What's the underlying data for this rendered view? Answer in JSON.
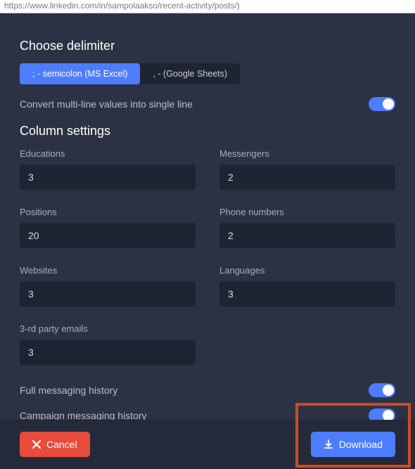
{
  "url": "https://www.linkedin.com/in/sampolaakso/recent-activity/posts/)",
  "delimiter": {
    "title": "Choose delimiter",
    "opt_semicolon": "; - semicolon (MS Excel)",
    "opt_comma": ", - (Google Sheets)"
  },
  "convert_line": "Convert multi-line values into single line",
  "columns": {
    "title": "Column settings",
    "educations_label": "Educations",
    "educations_value": "3",
    "messengers_label": "Messengers",
    "messengers_value": "2",
    "positions_label": "Positions",
    "positions_value": "20",
    "phones_label": "Phone numbers",
    "phones_value": "2",
    "websites_label": "Websites",
    "websites_value": "3",
    "languages_label": "Languages",
    "languages_value": "3",
    "emails_label": "3-rd party emails",
    "emails_value": "3"
  },
  "full_history": "Full messaging history",
  "campaign_history": "Campaign messaging history",
  "buttons": {
    "cancel": "Cancel",
    "download": "Download"
  }
}
